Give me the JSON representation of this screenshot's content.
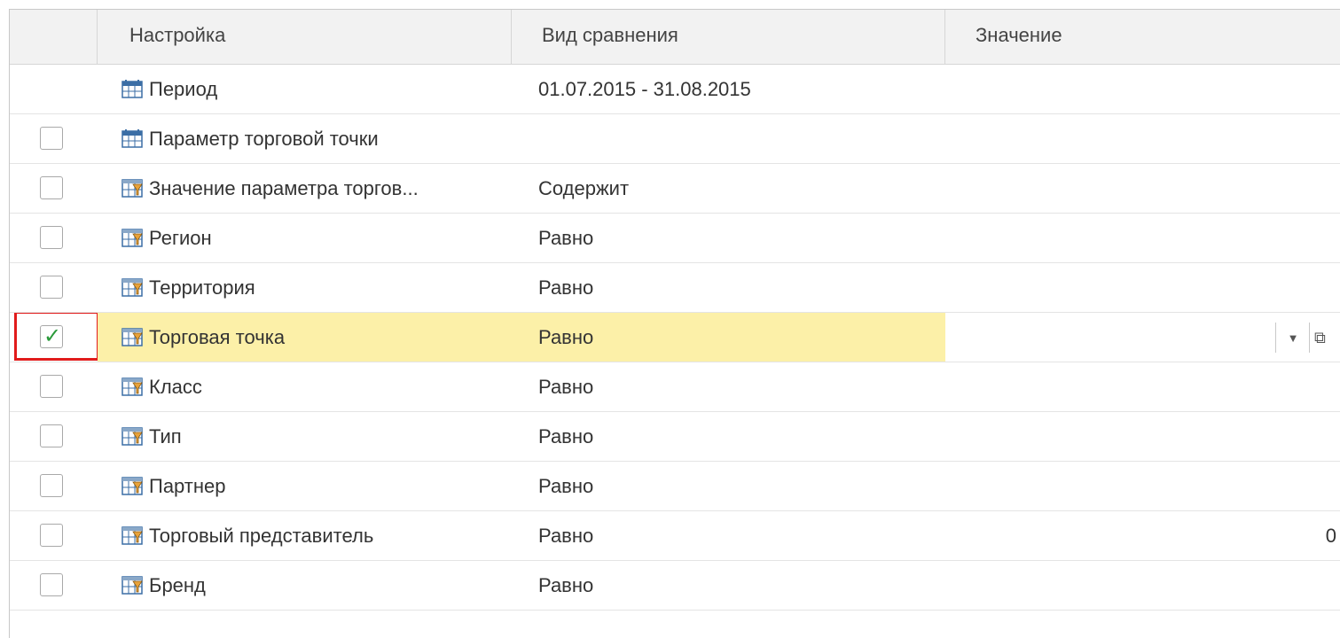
{
  "header": {
    "col_setting": "Настройка",
    "col_comparison": "Вид сравнения",
    "col_value": "Значение"
  },
  "rows": [
    {
      "label": "Период",
      "comparison": "01.07.2015 - 31.08.2015",
      "value": "",
      "checkbox": false,
      "checked": false,
      "icon": "calendar-period-icon"
    },
    {
      "label": "Параметр торговой точки",
      "comparison": "",
      "value": "",
      "checkbox": true,
      "checked": false,
      "icon": "calendar-period-icon"
    },
    {
      "label": "Значение параметра торгов...",
      "comparison": "Содержит",
      "value": "",
      "checkbox": true,
      "checked": false,
      "icon": "filter-icon"
    },
    {
      "label": "Регион",
      "comparison": "Равно",
      "value": "",
      "checkbox": true,
      "checked": false,
      "icon": "filter-icon"
    },
    {
      "label": "Территория",
      "comparison": "Равно",
      "value": "",
      "checkbox": true,
      "checked": false,
      "icon": "filter-icon"
    },
    {
      "label": "Торговая точка",
      "comparison": "Равно",
      "value": "",
      "checkbox": true,
      "checked": true,
      "icon": "filter-icon"
    },
    {
      "label": "Класс",
      "comparison": "Равно",
      "value": "",
      "checkbox": true,
      "checked": false,
      "icon": "filter-icon"
    },
    {
      "label": "Тип",
      "comparison": "Равно",
      "value": "",
      "checkbox": true,
      "checked": false,
      "icon": "filter-icon"
    },
    {
      "label": "Партнер",
      "comparison": "Равно",
      "value": "",
      "checkbox": true,
      "checked": false,
      "icon": "filter-icon"
    },
    {
      "label": "Торговый представитель",
      "comparison": "Равно",
      "value": "0",
      "checkbox": true,
      "checked": false,
      "icon": "filter-icon"
    },
    {
      "label": "Бренд",
      "comparison": "Равно",
      "value": "",
      "checkbox": true,
      "checked": false,
      "icon": "filter-icon"
    }
  ],
  "selected_row_index": 5,
  "colors": {
    "selected_row": "#fcf0a8",
    "highlight_border": "#e11b1b",
    "checkmark": "#2a9a3a",
    "header_bg": "#f2f2f2"
  }
}
